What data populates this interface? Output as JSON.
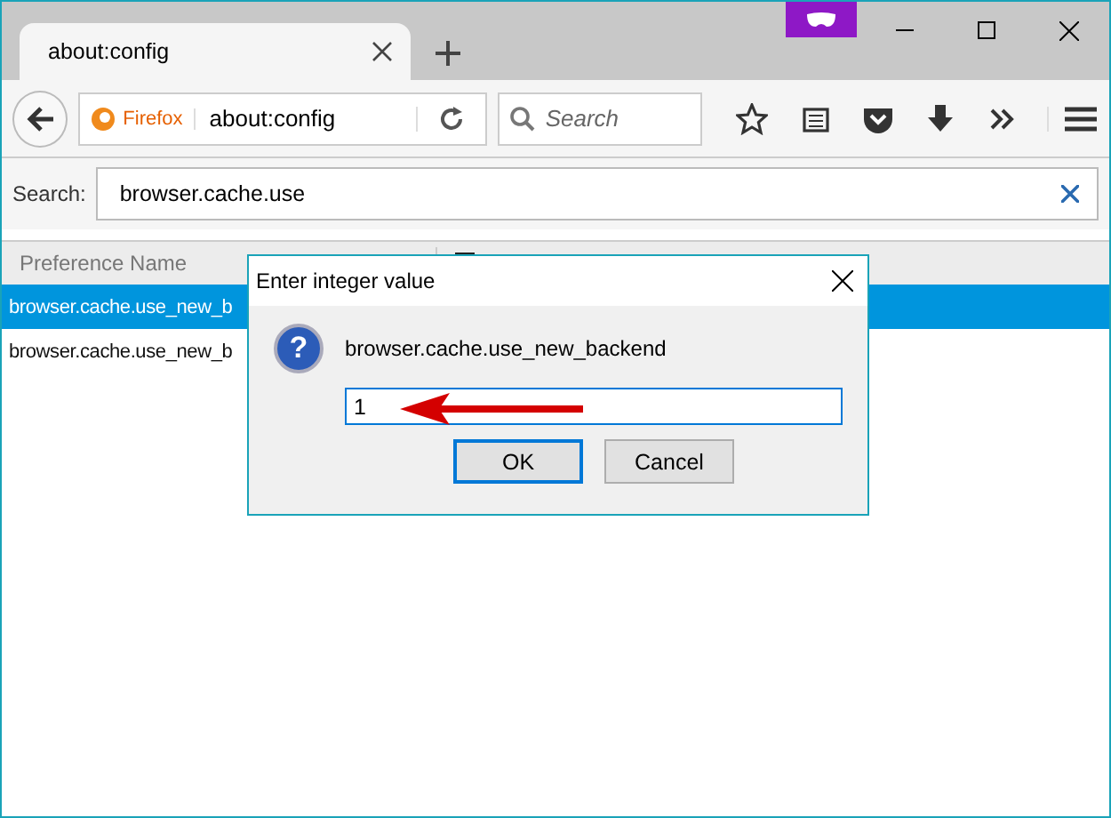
{
  "tabs": [
    {
      "label": "about:config",
      "selected": true
    }
  ],
  "nav": {
    "identity": "Firefox",
    "url": "about:config",
    "search_placeholder": "Search"
  },
  "filter": {
    "label": "Search:",
    "value": "browser.cache.use"
  },
  "table": {
    "columns": [
      "Preference Name"
    ],
    "rows": [
      {
        "name": "browser.cache.use_new_b",
        "selected": true
      },
      {
        "name": "browser.cache.use_new_b",
        "selected": false
      }
    ]
  },
  "dialog": {
    "title": "Enter integer value",
    "icon": "?",
    "message": "browser.cache.use_new_backend",
    "value": "1",
    "buttons": [
      {
        "label": "OK",
        "default": true
      },
      {
        "label": "Cancel",
        "default": false
      }
    ]
  }
}
